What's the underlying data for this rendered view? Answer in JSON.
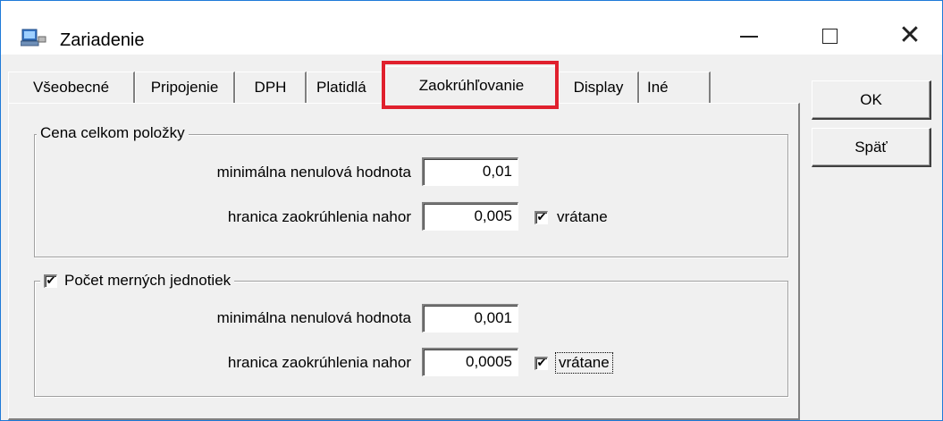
{
  "window": {
    "title": "Zariadenie",
    "icon": "computer-icon"
  },
  "controls": {
    "minimize": "minimize-icon",
    "maximize": "maximize-icon",
    "close": "close-icon",
    "close_glyph": "✕"
  },
  "tabs": [
    {
      "label": "Všeobecné"
    },
    {
      "label": "Pripojenie"
    },
    {
      "label": "DPH"
    },
    {
      "label": "Platidlá"
    },
    {
      "label": "Zaokrúhľovanie",
      "active": true
    },
    {
      "label": "Display"
    },
    {
      "label": "Iné"
    }
  ],
  "group1": {
    "title": "Cena celkom položky",
    "min_label": "minimálna nenulová hodnota",
    "min_value": "0,01",
    "limit_label": "hranica zaokrúhlenia nahor",
    "limit_value": "0,005",
    "incl_label": "vrátane",
    "incl_checked": true
  },
  "group2": {
    "title": "Počet merných jednotiek",
    "enabled": true,
    "min_label": "minimálna nenulová hodnota",
    "min_value": "0,001",
    "limit_label": "hranica zaokrúhlenia nahor",
    "limit_value": "0,0005",
    "incl_label": "vrátane",
    "incl_checked": true
  },
  "buttons": {
    "ok": "OK",
    "back": "Späť"
  },
  "check_glyph": "✔",
  "colors": {
    "highlight": "#e0202d",
    "border": "#1f7ad8"
  }
}
